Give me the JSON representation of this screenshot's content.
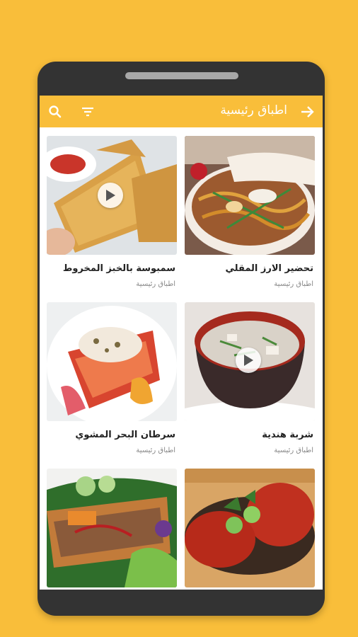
{
  "app_bar": {
    "title": "اطباق رئيسية",
    "icons": [
      "search-icon",
      "filter-icon",
      "back-arrow-icon"
    ],
    "color": "#F9BE3A"
  },
  "recipes": [
    {
      "name": "تحضير الارز المقلي",
      "category": "اطباق رئيسية",
      "video": false
    },
    {
      "name": "سمبوسة بالخبز المخروط",
      "category": "اطباق رئيسية",
      "video": true
    },
    {
      "name": "شربة هندية",
      "category": "اطباق رئيسية",
      "video": true
    },
    {
      "name": "سرطان البحر المشوي",
      "category": "اطباق رئيسية",
      "video": false
    },
    {
      "name": "",
      "category": "",
      "video": false
    },
    {
      "name": "",
      "category": "",
      "video": false
    }
  ],
  "colors": {
    "background": "#F9BE3A",
    "phone": "#333333"
  }
}
